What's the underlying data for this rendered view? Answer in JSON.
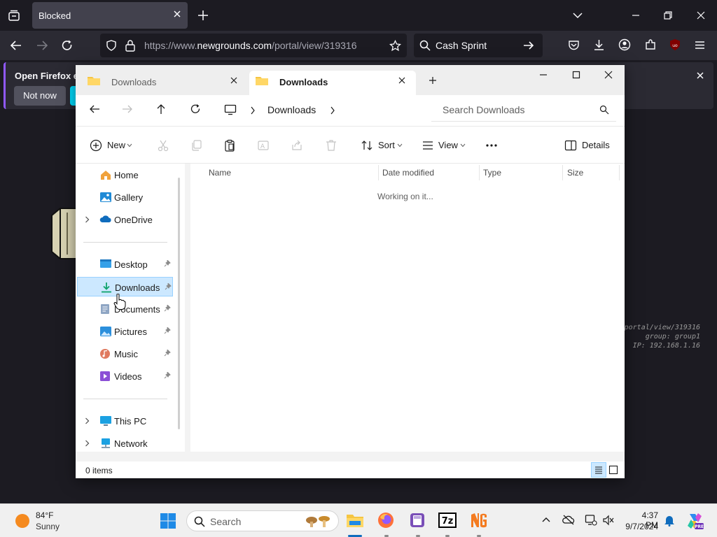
{
  "browser": {
    "tab_title": "Blocked",
    "url_prefix": "https://www.",
    "url_domain": "newgrounds.com",
    "url_path": "/portal/view/319316",
    "search_text": "Cash Sprint",
    "notice_text": "Open Firefox ev",
    "not_now_label": "Not now",
    "accent_color": "#9059ff"
  },
  "page": {
    "info_line1": "portal/view/319316",
    "info_line2": "group: group1",
    "info_line3": "IP: 192.168.1.16"
  },
  "explorer": {
    "tabs": [
      {
        "label": "Downloads",
        "active": false
      },
      {
        "label": "Downloads",
        "active": true
      }
    ],
    "breadcrumb": "Downloads",
    "search_placeholder": "Search Downloads",
    "commands": {
      "new": "New",
      "sort": "Sort",
      "view": "View",
      "details": "Details"
    },
    "nav": [
      {
        "label": "Home",
        "icon": "home-icon"
      },
      {
        "label": "Gallery",
        "icon": "gallery-icon"
      },
      {
        "label": "OneDrive",
        "icon": "cloud-icon"
      },
      {
        "label": "Desktop",
        "icon": "desktop-icon"
      },
      {
        "label": "Downloads",
        "icon": "download-icon"
      },
      {
        "label": "Documents",
        "icon": "document-icon"
      },
      {
        "label": "Pictures",
        "icon": "pictures-icon"
      },
      {
        "label": "Music",
        "icon": "music-icon"
      },
      {
        "label": "Videos",
        "icon": "videos-icon"
      },
      {
        "label": "This PC",
        "icon": "computer-icon"
      },
      {
        "label": "Network",
        "icon": "network-icon"
      }
    ],
    "columns": [
      "Name",
      "Date modified",
      "Type",
      "Size"
    ],
    "loading_text": "Working on it...",
    "status": "0 items",
    "selection_color": "#cce8ff"
  },
  "taskbar": {
    "temperature": "84°F",
    "condition": "Sunny",
    "search_label": "Search",
    "time": "4:37 PM",
    "date": "9/7/2024"
  }
}
